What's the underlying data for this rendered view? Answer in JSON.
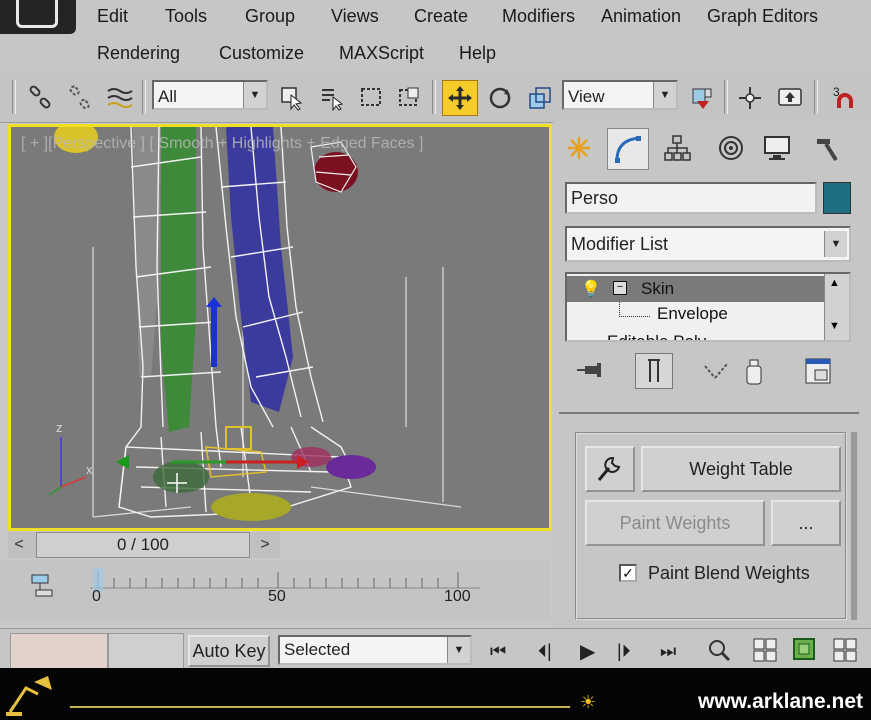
{
  "menu": {
    "row1": [
      "Edit",
      "Tools",
      "Group",
      "Views",
      "Create",
      "Modifiers",
      "Animation",
      "Graph Editors"
    ],
    "row2": [
      "Rendering",
      "Customize",
      "MAXScript",
      "Help"
    ]
  },
  "toolbar": {
    "selection_filter": "All",
    "reference_coord": "View"
  },
  "viewport": {
    "label": "[ + ][Perspective ] [ Smooth + Highlights + Edged Faces ]",
    "axis_z": "z",
    "axis_x": "x"
  },
  "time": {
    "frame_display": "0 / 100",
    "prev_arrow": "<",
    "next_arrow": ">",
    "track_labels": [
      "0",
      "50",
      "100"
    ]
  },
  "panel": {
    "object_name": "Perso",
    "object_color": "#1f6f82",
    "modifier_list_label": "Modifier List",
    "stack": {
      "item1": "Skin",
      "item2": "Envelope",
      "item3": "Editable Poly"
    },
    "weight_table_label": "Weight Table",
    "paint_weights_label": "Paint Weights",
    "ellipsis_label": "...",
    "paint_blend_label": "Paint Blend Weights",
    "paint_blend_checked": true
  },
  "bottom": {
    "auto_key_label": "Auto Key",
    "key_mode_value": "Selected"
  },
  "footer": {
    "url": "www.arklane.net"
  },
  "colors": {
    "viewport_border": "#f0e020",
    "accent_highlight": "#f5cc2a"
  }
}
